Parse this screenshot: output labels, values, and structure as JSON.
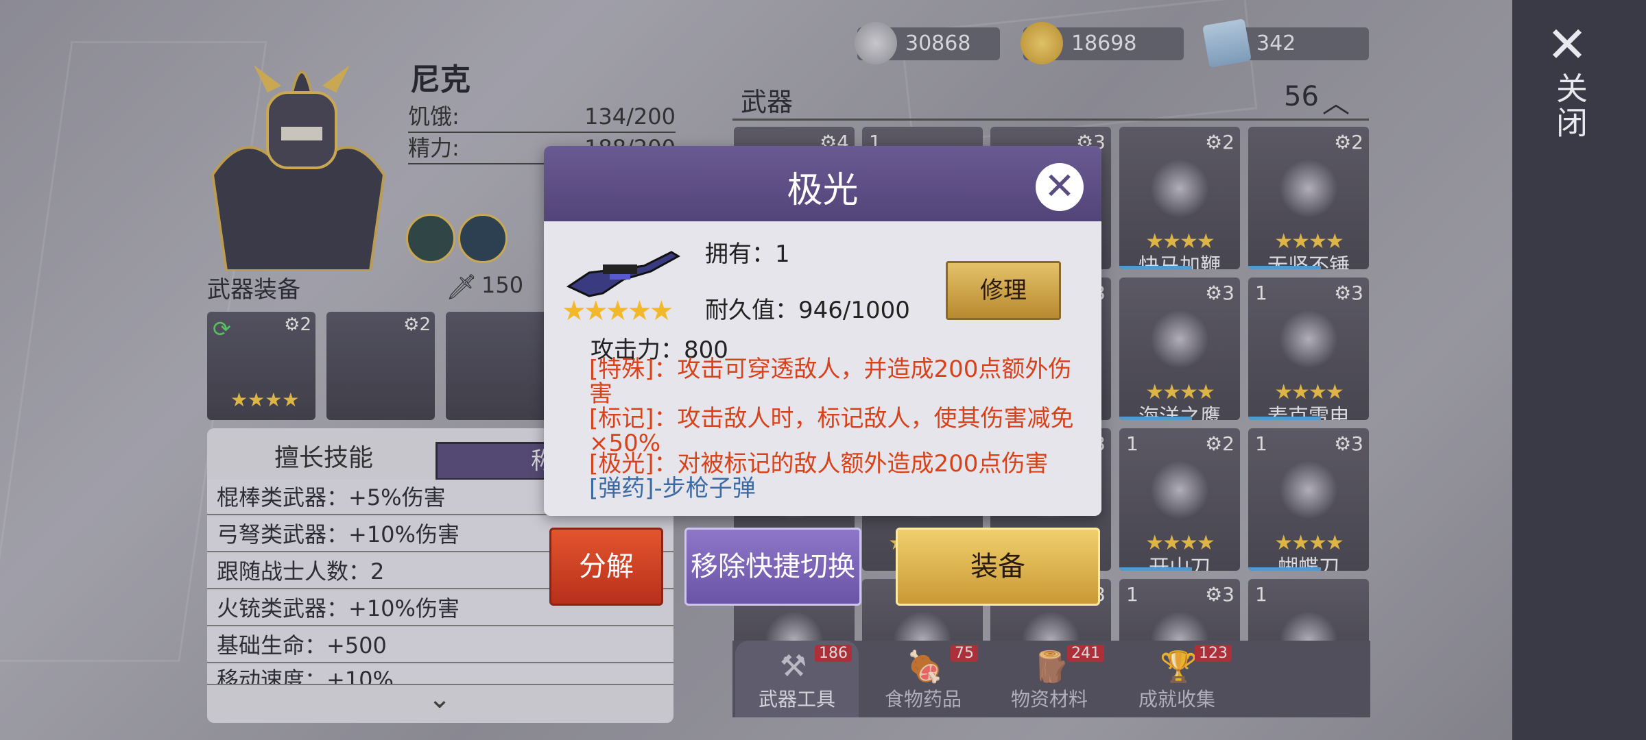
{
  "currencies": [
    {
      "icon": "silver-coin-stack-icon",
      "value": "30868"
    },
    {
      "icon": "gold-smiley-coin-icon",
      "value": "18698"
    },
    {
      "icon": "ticket-card-icon",
      "value": "342"
    }
  ],
  "side_panel": {
    "close_label": "关闭"
  },
  "character": {
    "name": "尼克",
    "stats": [
      {
        "label": "饥饿:",
        "value": "134/200"
      },
      {
        "label": "精力:",
        "value": "188/200"
      }
    ]
  },
  "equipment": {
    "title": "武器装备",
    "power": "150",
    "slots": [
      {
        "level": "2"
      },
      {
        "level": "2"
      },
      {
        "level": ""
      }
    ]
  },
  "skills": {
    "tab_active": "擅长技能",
    "tab_other": "称号",
    "rows": [
      "棍棒类武器：+5%伤害",
      "弓弩类武器：+10%伤害",
      "跟随战士人数：2",
      "火铳类武器：+10%伤害",
      "基础生命：+500",
      "移动速度：+10%"
    ]
  },
  "weapons": {
    "title": "武器",
    "count": "56",
    "cells": [
      {
        "count": "",
        "level": "4",
        "name": "",
        "stars": "★★★★"
      },
      {
        "count": "1",
        "level": "",
        "name": "",
        "stars": "★★★★"
      },
      {
        "count": "",
        "level": "3",
        "name": "",
        "stars": "★★★★"
      },
      {
        "count": "",
        "level": "2",
        "name": "快马加鞭",
        "stars": "★★★★"
      },
      {
        "count": "",
        "level": "2",
        "name": "无坚不锤",
        "stars": "★★★★"
      },
      {
        "count": "",
        "level": "",
        "name": "",
        "stars": ""
      },
      {
        "count": "",
        "level": "",
        "name": "",
        "stars": ""
      },
      {
        "count": "",
        "level": "3",
        "name": "",
        "stars": ""
      },
      {
        "count": "",
        "level": "3",
        "name": "海洋之鹰",
        "stars": "★★★★"
      },
      {
        "count": "1",
        "level": "3",
        "name": "麦克雷电",
        "stars": "★★★★"
      },
      {
        "count": "",
        "level": "",
        "name": "",
        "stars": "★★★★"
      },
      {
        "count": "",
        "level": "",
        "name": "",
        "stars": "★★★★"
      },
      {
        "count": "",
        "level": "3",
        "name": "",
        "stars": "★★★★"
      },
      {
        "count": "1",
        "level": "2",
        "name": "开山刀",
        "stars": "★★★★"
      },
      {
        "count": "1",
        "level": "3",
        "name": "蝴蝶刀",
        "stars": "★★★★"
      },
      {
        "count": "",
        "level": "",
        "name": "",
        "stars": ""
      },
      {
        "count": "",
        "level": "",
        "name": "",
        "stars": ""
      },
      {
        "count": "",
        "level": "3",
        "name": "",
        "stars": ""
      },
      {
        "count": "1",
        "level": "3",
        "name": "",
        "stars": ""
      },
      {
        "count": "1",
        "level": "",
        "name": "",
        "stars": ""
      }
    ]
  },
  "tabs": [
    {
      "label": "武器工具",
      "count": "186"
    },
    {
      "label": "食物药品",
      "count": "75"
    },
    {
      "label": "物资材料",
      "count": "241"
    },
    {
      "label": "成就收集",
      "count": "123"
    }
  ],
  "dialog": {
    "title": "极光",
    "owned": "拥有：1",
    "durability": "耐久值：946/1000",
    "repair": "修理",
    "stars": "★★★★★",
    "attack": "攻击力：800",
    "lines": [
      {
        "text": "[特殊]：攻击可穿透敌人，并造成200点额外伤害",
        "color": "red"
      },
      {
        "text": "[标记]：攻击敌人时，标记敌人，使其伤害减免×50%",
        "color": "red"
      },
      {
        "text": "[极光]：对被标记的敌人额外造成200点伤害",
        "color": "red"
      },
      {
        "text": "[弹药]-步枪子弹",
        "color": "blue"
      }
    ]
  },
  "actions": {
    "decompose": "分解",
    "remove_quick": "移除快捷切换",
    "equip": "装备"
  },
  "colors": {
    "accent_purple": "#5a4b80",
    "gold": "#d9a93c",
    "red_text": "#d8421a",
    "blue_text": "#3c6ba4"
  }
}
